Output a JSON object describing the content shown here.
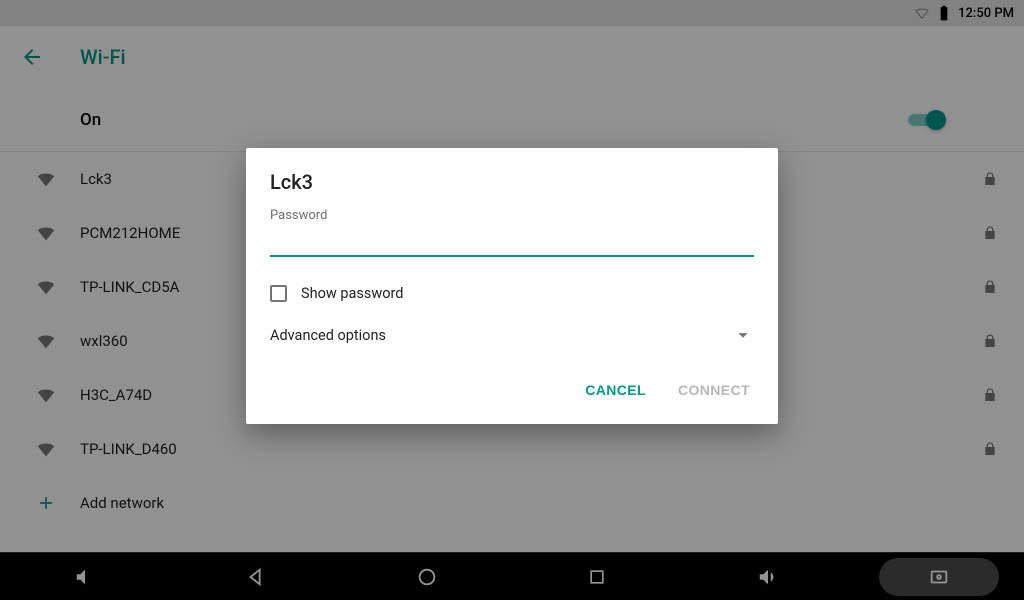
{
  "status_bar": {
    "time": "12:50 PM"
  },
  "app_bar": {
    "title": "Wi-Fi"
  },
  "toggle": {
    "label": "On",
    "state": true
  },
  "networks": [
    {
      "name": "Lck3",
      "locked": true
    },
    {
      "name": "PCM212HOME",
      "locked": true
    },
    {
      "name": "TP-LINK_CD5A",
      "locked": true
    },
    {
      "name": "wxl360",
      "locked": true
    },
    {
      "name": "H3C_A74D",
      "locked": true
    },
    {
      "name": "TP-LINK_D460",
      "locked": true
    }
  ],
  "add_network_label": "Add network",
  "dialog": {
    "title": "Lck3",
    "password_label": "Password",
    "password_value": "",
    "show_password_label": "Show password",
    "advanced_label": "Advanced options",
    "cancel_label": "CANCEL",
    "connect_label": "CONNECT"
  },
  "colors": {
    "accent": "#009688"
  }
}
